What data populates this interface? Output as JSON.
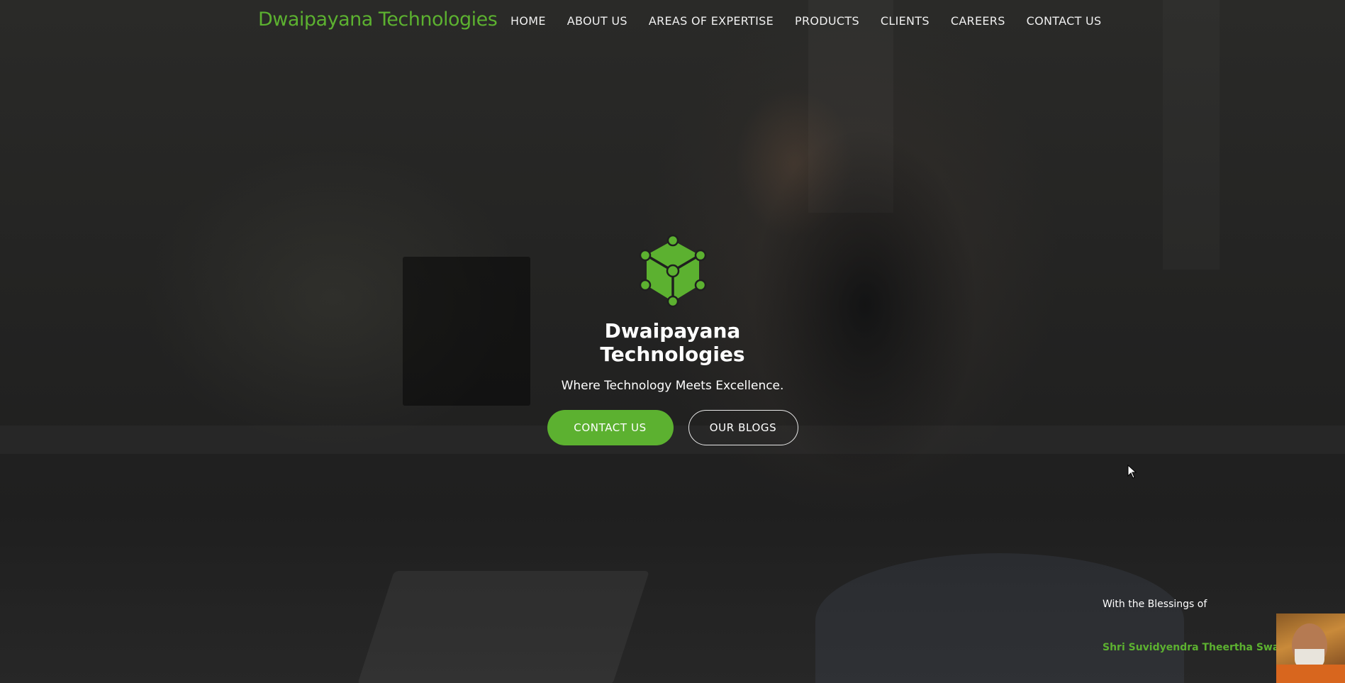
{
  "navbar": {
    "brand": "Dwaipayana Technologies",
    "links": [
      {
        "label": "HOME"
      },
      {
        "label": "ABOUT US"
      },
      {
        "label": "AREAS OF EXPERTISE"
      },
      {
        "label": "PRODUCTS"
      },
      {
        "label": "CLIENTS"
      },
      {
        "label": "CAREERS"
      },
      {
        "label": "CONTACT US"
      }
    ]
  },
  "hero": {
    "logo_icon": "cube-network-icon",
    "title": "Dwaipayana Technologies",
    "tagline": "Where Technology Meets Excellence.",
    "primary_button": "CONTACT US",
    "secondary_button": "OUR BLOGS"
  },
  "blessing": {
    "label": "With the Blessings of",
    "name": "Shri Suvidyendra Theertha Swamiji"
  },
  "colors": {
    "accent": "#5cb130",
    "text": "#ffffff"
  }
}
